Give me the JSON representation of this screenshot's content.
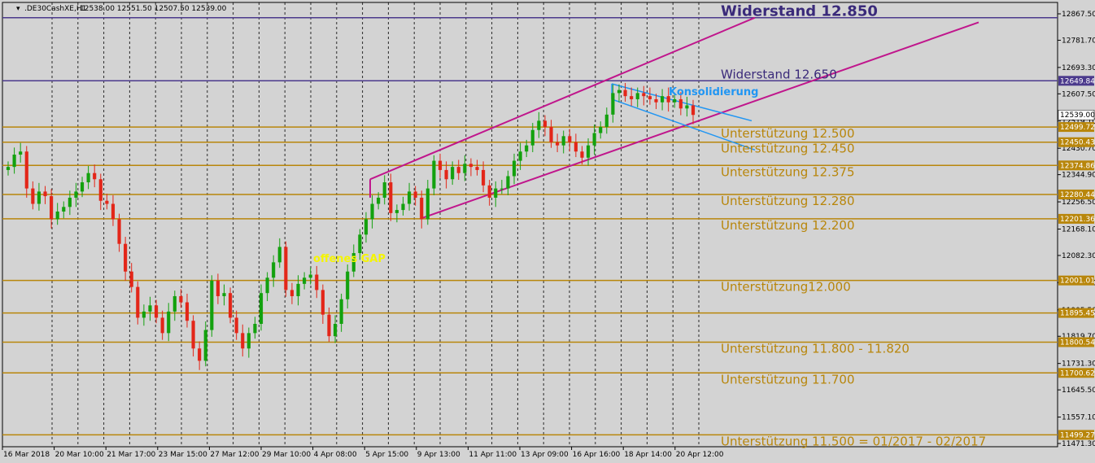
{
  "header": {
    "symbol": ".DE30CashXE,H1",
    "ohlc": "12538.00 12551.50 12507.50 12539.00"
  },
  "chart_data": {
    "type": "candlestick",
    "y_range": [
      11471.3,
      12895.0
    ],
    "price_ticks": [
      "12867.50",
      "12781.70",
      "12693.30",
      "12607.50",
      "12519.10",
      "12430.70",
      "12344.90",
      "12256.50",
      "12168.10",
      "12082.30",
      "11993.90",
      "11905.50",
      "11819.70",
      "11731.30",
      "11645.50",
      "11557.10",
      "11471.30"
    ],
    "x_labels": [
      "16 Mar 2018",
      "20 Mar 10:00",
      "21 Mar 17:00",
      "23 Mar 15:00",
      "27 Mar 12:00",
      "29 Mar 10:00",
      "4 Apr 08:00",
      "5 Apr 15:00",
      "9 Apr 13:00",
      "11 Apr 11:00",
      "13 Apr 09:00",
      "16 Apr 16:00",
      "18 Apr 14:00",
      "20 Apr 12:00"
    ],
    "current_price": "12539.00",
    "levels": [
      {
        "price": 12855.0,
        "kind": "resistance",
        "label": "Widerstand 12.850",
        "tag": ""
      },
      {
        "price": 12649.84,
        "kind": "resistance",
        "label": "Widerstand 12.650",
        "tag": "12649.84"
      },
      {
        "price": 12499.72,
        "kind": "support",
        "label": "Unterstützung 12.500",
        "tag": "12499.72"
      },
      {
        "price": 12450.43,
        "kind": "support",
        "label": "Unterstützung 12.450",
        "tag": "12450.43"
      },
      {
        "price": 12374.86,
        "kind": "support",
        "label": "Unterstützung 12.375",
        "tag": "12374.86"
      },
      {
        "price": 12280.44,
        "kind": "support",
        "label": "Unterstützung 12.280",
        "tag": "12280.44"
      },
      {
        "price": 12201.36,
        "kind": "support",
        "label": "Unterstützung 12.200",
        "tag": "12201.36"
      },
      {
        "price": 12001.01,
        "kind": "support",
        "label": "Unterstützung12.000",
        "tag": "12001.01"
      },
      {
        "price": 11895.45,
        "kind": "support",
        "label": "",
        "tag": "11895.45"
      },
      {
        "price": 11800.54,
        "kind": "support",
        "label": "Unterstützung 11.800 - 11.820",
        "tag": "11800.54"
      },
      {
        "price": 11700.62,
        "kind": "support",
        "label": "Unterstützung 11.700",
        "tag": "11700.62"
      },
      {
        "price": 11499.27,
        "kind": "support",
        "label": "Unterstützung 11.500 = 01/2017 - 02/2017",
        "tag": "11499.27"
      }
    ],
    "annotations": {
      "consolidation": "Konsolidierung",
      "gap": "offenes GAP"
    },
    "closes": [
      12370,
      12410,
      12420,
      12300,
      12250,
      12290,
      12275,
      12200,
      12225,
      12240,
      12270,
      12290,
      12320,
      12350,
      12330,
      12260,
      12250,
      12200,
      12120,
      12030,
      11980,
      11880,
      11900,
      11920,
      11880,
      11830,
      11900,
      11950,
      11930,
      11870,
      11780,
      11740,
      11840,
      12000,
      11950,
      11960,
      11880,
      11830,
      11780,
      11830,
      11860,
      11960,
      12010,
      12060,
      12110,
      11970,
      11950,
      11990,
      12010,
      12020,
      11970,
      11890,
      11820,
      11860,
      11940,
      12030,
      12090,
      12150,
      12200,
      12250,
      12270,
      12320,
      12220,
      12230,
      12250,
      12290,
      12270,
      12200,
      12300,
      12390,
      12360,
      12330,
      12370,
      12350,
      12380,
      12370,
      12360,
      12310,
      12270,
      12300,
      12300,
      12340,
      12390,
      12420,
      12440,
      12490,
      12520,
      12500,
      12450,
      12440,
      12470,
      12450,
      12420,
      12400,
      12440,
      12480,
      12500,
      12540,
      12610,
      12620,
      12600,
      12590,
      12610,
      12600,
      12590,
      12580,
      12600,
      12580,
      12590,
      12560,
      12570,
      12539
    ]
  }
}
